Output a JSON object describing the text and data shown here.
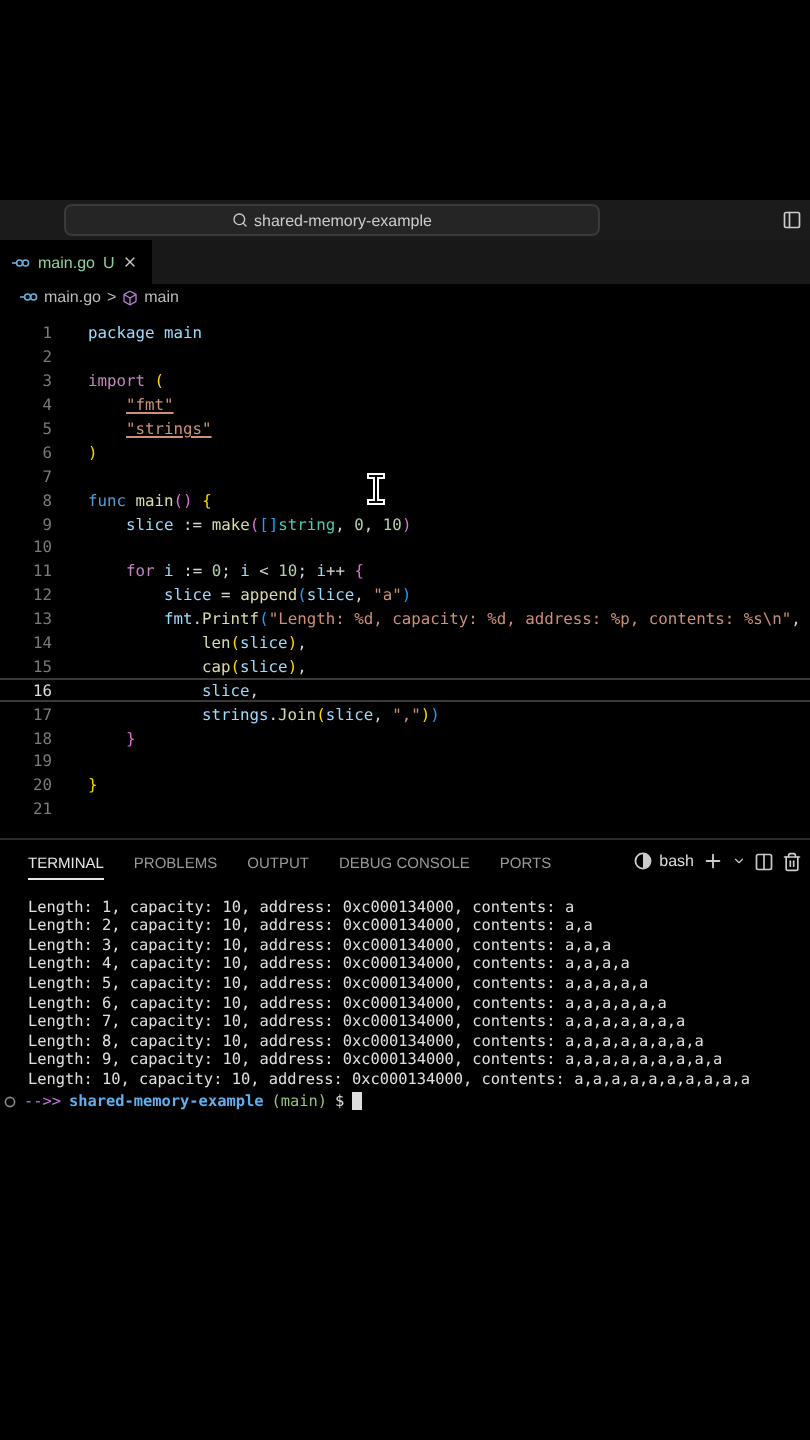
{
  "title_bar": {
    "search": "shared-memory-example"
  },
  "tabs": [
    {
      "label": "main.go",
      "status": "U",
      "selected": true
    }
  ],
  "breadcrumb": {
    "file": "main.go",
    "separator": ">",
    "symbol": "main"
  },
  "code_lines": [
    {
      "number": "1",
      "active": false,
      "tokens": [
        {
          "kind": "var",
          "text": "package main"
        }
      ]
    },
    {
      "number": "2",
      "active": false
    },
    {
      "number": "3",
      "active": false,
      "tokens": [
        {
          "kind": "kw",
          "text": "import"
        },
        {
          "kind": "bracket",
          "text": " ("
        }
      ]
    },
    {
      "number": "4",
      "active": false,
      "tokens": [
        {
          "kind": "import",
          "text": "    \"fmt\""
        }
      ]
    },
    {
      "number": "5",
      "active": false,
      "tokens": [
        {
          "kind": "import",
          "text": "    \"strings\""
        }
      ]
    },
    {
      "number": "6",
      "active": false,
      "tokens": [
        {
          "kind": "bracket",
          "text": ")"
        }
      ]
    },
    {
      "number": "7",
      "active": false
    },
    {
      "number": "8",
      "active": false,
      "tokens": [
        {
          "kind": "decl",
          "text": "func"
        },
        {
          "kind": "fn",
          "text": " main"
        },
        {
          "kind": "bracket2",
          "text": "()"
        },
        {
          "kind": "bracket",
          "text": " {"
        }
      ]
    },
    {
      "number": "9",
      "active": false,
      "tokens": [
        {
          "kind": "var",
          "text": "    slice"
        },
        {
          "kind": "plain",
          "text": " := "
        },
        {
          "kind": "fn",
          "text": "make"
        },
        {
          "kind": "bracket2",
          "text": "("
        },
        {
          "kind": "bracket3",
          "text": "[]"
        },
        {
          "kind": "type",
          "text": "string"
        },
        {
          "kind": "plain",
          "text": ", "
        },
        {
          "kind": "num",
          "text": "0"
        },
        {
          "kind": "plain",
          "text": ", "
        },
        {
          "kind": "num",
          "text": "10"
        },
        {
          "kind": "bracket2",
          "text": ")"
        }
      ]
    },
    {
      "number": "10",
      "active": false
    },
    {
      "number": "11",
      "active": false,
      "tokens": [
        {
          "kind": "kw",
          "text": "    for"
        },
        {
          "kind": "var",
          "text": " i"
        },
        {
          "kind": "plain",
          "text": " := "
        },
        {
          "kind": "num",
          "text": "0"
        },
        {
          "kind": "plain",
          "text": "; "
        },
        {
          "kind": "var",
          "text": "i"
        },
        {
          "kind": "plain",
          "text": " < "
        },
        {
          "kind": "num",
          "text": "10"
        },
        {
          "kind": "plain",
          "text": "; "
        },
        {
          "kind": "var",
          "text": "i"
        },
        {
          "kind": "plain",
          "text": "++ "
        },
        {
          "kind": "bracket2",
          "text": "{"
        }
      ]
    },
    {
      "number": "12",
      "active": false,
      "tokens": [
        {
          "kind": "var",
          "text": "        slice"
        },
        {
          "kind": "plain",
          "text": " = "
        },
        {
          "kind": "fn",
          "text": "append"
        },
        {
          "kind": "bracket3",
          "text": "("
        },
        {
          "kind": "var",
          "text": "slice"
        },
        {
          "kind": "plain",
          "text": ", "
        },
        {
          "kind": "str",
          "text": "\"a\""
        },
        {
          "kind": "bracket3",
          "text": ")"
        }
      ]
    },
    {
      "number": "13",
      "active": false,
      "tokens": [
        {
          "kind": "var",
          "text": "        fmt"
        },
        {
          "kind": "plain",
          "text": "."
        },
        {
          "kind": "fn",
          "text": "Printf"
        },
        {
          "kind": "bracket3",
          "text": "("
        },
        {
          "kind": "str",
          "text": "\"Length: %d, capacity: %d, address: %p, contents: %s\\n\""
        },
        {
          "kind": "plain",
          "text": ","
        }
      ]
    },
    {
      "number": "14",
      "active": false,
      "tokens": [
        {
          "kind": "fn",
          "text": "            len"
        },
        {
          "kind": "bracket",
          "text": "("
        },
        {
          "kind": "var",
          "text": "slice"
        },
        {
          "kind": "bracket",
          "text": ")"
        },
        {
          "kind": "plain",
          "text": ","
        }
      ]
    },
    {
      "number": "15",
      "active": false,
      "tokens": [
        {
          "kind": "fn",
          "text": "            cap"
        },
        {
          "kind": "bracket",
          "text": "("
        },
        {
          "kind": "var",
          "text": "slice"
        },
        {
          "kind": "bracket",
          "text": ")"
        },
        {
          "kind": "plain",
          "text": ","
        }
      ]
    },
    {
      "number": "16",
      "active": true,
      "tokens": [
        {
          "kind": "var",
          "text": "            slice"
        },
        {
          "kind": "plain",
          "text": ","
        }
      ]
    },
    {
      "number": "17",
      "active": false,
      "tokens": [
        {
          "kind": "var",
          "text": "            strings"
        },
        {
          "kind": "plain",
          "text": "."
        },
        {
          "kind": "fn",
          "text": "Join"
        },
        {
          "kind": "bracket",
          "text": "("
        },
        {
          "kind": "var",
          "text": "slice"
        },
        {
          "kind": "plain",
          "text": ", "
        },
        {
          "kind": "str",
          "text": "\",\""
        },
        {
          "kind": "bracket",
          "text": ")"
        },
        {
          "kind": "bracket3",
          "text": ")"
        }
      ]
    },
    {
      "number": "18",
      "active": false,
      "tokens": [
        {
          "kind": "bracket2",
          "text": "    }"
        }
      ]
    },
    {
      "number": "19",
      "active": false
    },
    {
      "number": "20",
      "active": false,
      "tokens": [
        {
          "kind": "bracket",
          "text": "}"
        }
      ]
    },
    {
      "number": "21",
      "active": false
    }
  ],
  "panel_tabs": [
    {
      "label": "TERMINAL",
      "selected": true
    },
    {
      "label": "PROBLEMS",
      "selected": false
    },
    {
      "label": "OUTPUT",
      "selected": false
    },
    {
      "label": "DEBUG CONSOLE",
      "selected": false
    },
    {
      "label": "PORTS",
      "selected": false
    }
  ],
  "terminal_shell": "bash",
  "terminal_output": [
    "Length: 1, capacity: 10, address: 0xc000134000, contents: a",
    "Length: 2, capacity: 10, address: 0xc000134000, contents: a,a",
    "Length: 3, capacity: 10, address: 0xc000134000, contents: a,a,a",
    "Length: 4, capacity: 10, address: 0xc000134000, contents: a,a,a,a",
    "Length: 5, capacity: 10, address: 0xc000134000, contents: a,a,a,a,a",
    "Length: 6, capacity: 10, address: 0xc000134000, contents: a,a,a,a,a,a",
    "Length: 7, capacity: 10, address: 0xc000134000, contents: a,a,a,a,a,a,a",
    "Length: 8, capacity: 10, address: 0xc000134000, contents: a,a,a,a,a,a,a,a",
    "Length: 9, capacity: 10, address: 0xc000134000, contents: a,a,a,a,a,a,a,a,a",
    "Length: 10, capacity: 10, address: 0xc000134000, contents: a,a,a,a,a,a,a,a,a,a"
  ],
  "prompt": {
    "arrow": "-->>",
    "directory": "shared-memory-example",
    "branch": "(main)",
    "symbol": "$"
  }
}
